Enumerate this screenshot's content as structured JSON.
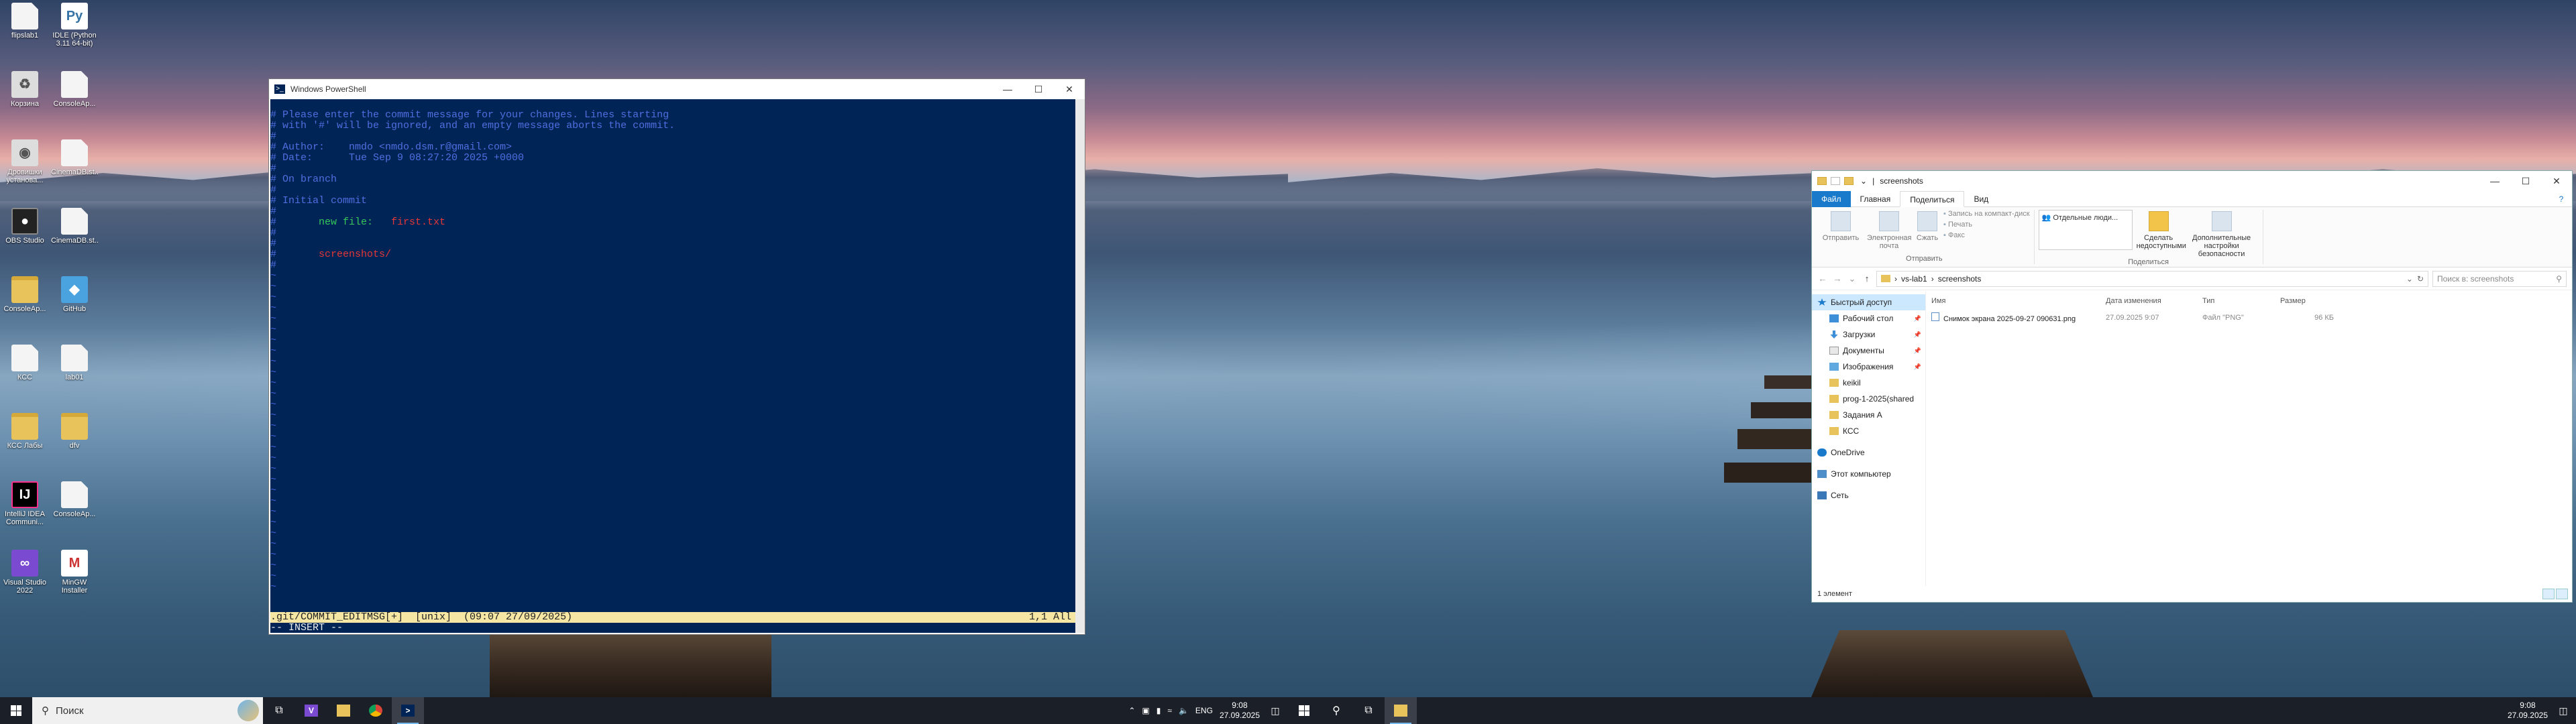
{
  "desktop_icons": [
    {
      "label": "flipslab1",
      "type": "file"
    },
    {
      "label": "IDLE (Python 3.11 64-bit)",
      "type": "python"
    },
    {
      "label": "Корзина",
      "type": "recycle"
    },
    {
      "label": "ConsoleAp...",
      "type": "file"
    },
    {
      "label": "Дровишки установа...",
      "type": "circle"
    },
    {
      "label": "CinemaDB.st...",
      "type": "file"
    },
    {
      "label": "OBS Studio",
      "type": "obs"
    },
    {
      "label": "CinemaDB.st...",
      "type": "file"
    },
    {
      "label": "ConsoleAp...",
      "type": "folder"
    },
    {
      "label": "GitHub",
      "type": "cube"
    },
    {
      "label": "КСС",
      "type": "file"
    },
    {
      "label": "lab01",
      "type": "file"
    },
    {
      "label": "КСС Лабы",
      "type": "folder"
    },
    {
      "label": "dfv",
      "type": "folder"
    },
    {
      "label": "IntelliJ IDEA Communi...",
      "type": "idea"
    },
    {
      "label": "ConsoleAp...",
      "type": "file"
    },
    {
      "label": "Visual Studio 2022",
      "type": "vs"
    },
    {
      "label": "MinGW Installer",
      "type": "mingw"
    }
  ],
  "powershell": {
    "title": "Windows PowerShell",
    "icon": "powershell-icon",
    "lines": [
      {
        "text": "",
        "cls": "blue"
      },
      {
        "text": "# Please enter the commit message for your changes. Lines starting",
        "cls": "blue"
      },
      {
        "text": "# with '#' will be ignored, and an empty message aborts the commit.",
        "cls": "blue"
      },
      {
        "text": "#",
        "cls": "blue"
      },
      {
        "text": "# Author:    nmdo <nmdo.dsm.r@gmail.com>",
        "cls": "blue"
      },
      {
        "text": "# Date:      Tue Sep 9 08:27:20 2025 +0000",
        "cls": "blue"
      },
      {
        "text": "#",
        "cls": "blue"
      },
      {
        "text": "# On branch ",
        "cls": "blue"
      },
      {
        "text": "#",
        "cls": "blue"
      },
      {
        "text": "# Initial commit",
        "cls": "blue"
      },
      {
        "text": "#",
        "cls": "blue"
      }
    ],
    "staged_prefix": "#\t",
    "staged_label": "new file:",
    "staged_file": "first.txt",
    "untracked_prefix": "#\t",
    "untracked": "screenshots/",
    "tilde_count": 30,
    "status_left": ".git/COMMIT_EDITMSG[+]  [unix]  (09:07 27/09/2025)",
    "status_right": "1,1 All",
    "mode": "-- INSERT --"
  },
  "explorer": {
    "title": "screenshots",
    "tabs": [
      "Файл",
      "Главная",
      "Поделиться",
      "Вид"
    ],
    "active_tab": "Поделиться",
    "ribbon": {
      "send_group": "Отправить",
      "share_group": "Поделиться",
      "send_buttons": [
        "Отправить",
        "Электронная почта",
        "Сжать"
      ],
      "small_buttons": [
        "Запись на компакт-диск",
        "Печать",
        "Факс"
      ],
      "share_combo": "Отдельные люди...",
      "share_buttons": [
        "Сделать недоступными",
        "Дополнительные настройки безопасности"
      ]
    },
    "path": [
      "vs-lab1",
      "screenshots"
    ],
    "search_placeholder": "Поиск в: screenshots",
    "nav": [
      {
        "label": "Быстрый доступ",
        "icon": "star",
        "sub": false,
        "sel": true,
        "pin": false
      },
      {
        "label": "Рабочий стол",
        "icon": "desk",
        "sub": true,
        "sel": false,
        "pin": true
      },
      {
        "label": "Загрузки",
        "icon": "down",
        "sub": true,
        "sel": false,
        "pin": true
      },
      {
        "label": "Документы",
        "icon": "doc",
        "sub": true,
        "sel": false,
        "pin": true
      },
      {
        "label": "Изображения",
        "icon": "img",
        "sub": true,
        "sel": false,
        "pin": true
      },
      {
        "label": "keikil",
        "icon": "fold",
        "sub": true,
        "sel": false,
        "pin": false
      },
      {
        "label": "prog-1-2025(shared",
        "icon": "fold",
        "sub": true,
        "sel": false,
        "pin": false
      },
      {
        "label": "Задания A",
        "icon": "fold",
        "sub": true,
        "sel": false,
        "pin": false
      },
      {
        "label": "КСС",
        "icon": "fold",
        "sub": true,
        "sel": false,
        "pin": false
      },
      {
        "label": "OneDrive",
        "icon": "cloud",
        "sub": false,
        "sel": false,
        "pin": false,
        "gap": true
      },
      {
        "label": "Этот компьютер",
        "icon": "pc",
        "sub": false,
        "sel": false,
        "pin": false,
        "gap": true
      },
      {
        "label": "Сеть",
        "icon": "net",
        "sub": false,
        "sel": false,
        "pin": false,
        "gap": true
      }
    ],
    "columns": [
      "Имя",
      "Дата изменения",
      "Тип",
      "Размер"
    ],
    "files": [
      {
        "name": "Снимок экрана 2025-09-27 090631.png",
        "date": "27.09.2025 9:07",
        "type": "Файл \"PNG\"",
        "size": "96 КБ"
      }
    ],
    "status": "1 элемент"
  },
  "taskbar_left": {
    "search_placeholder": "Поиск",
    "tray_lang": "ENG",
    "time": "9:08",
    "date": "27.09.2025"
  },
  "taskbar_right": {
    "time": "9:08",
    "date": "27.09.2025"
  }
}
